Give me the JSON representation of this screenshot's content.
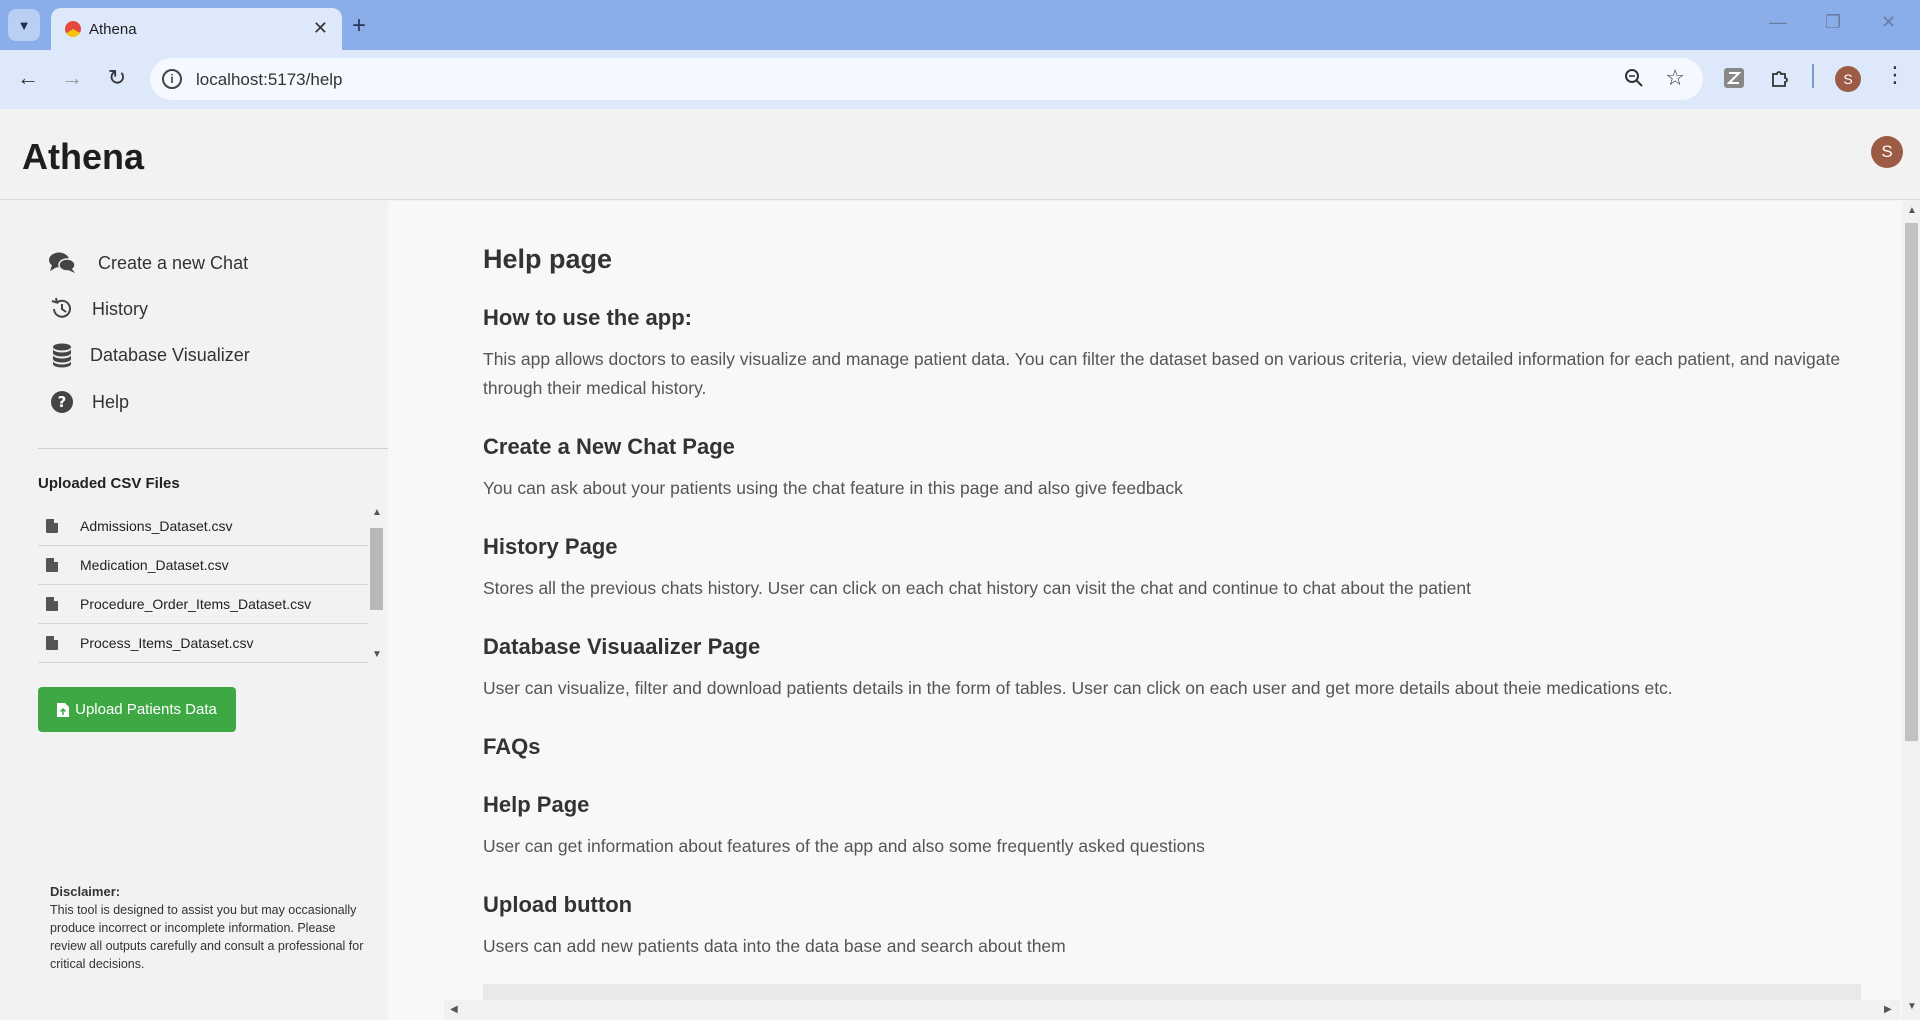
{
  "browser": {
    "tab_title": "Athena",
    "url": "localhost:5173/help",
    "profile_initial": "S"
  },
  "app": {
    "title": "Athena",
    "avatar_initial": "S"
  },
  "sidebar": {
    "nav": [
      {
        "label": "Create a new Chat",
        "icon": "chat-icon"
      },
      {
        "label": "History",
        "icon": "history-icon"
      },
      {
        "label": "Database Visualizer",
        "icon": "database-icon"
      },
      {
        "label": "Help",
        "icon": "help-icon"
      }
    ],
    "csv_title": "Uploaded CSV Files",
    "csv_files": [
      "Admissions_Dataset.csv",
      "Medication_Dataset.csv",
      "Procedure_Order_Items_Dataset.csv",
      "Process_Items_Dataset.csv"
    ],
    "upload_label": "Upload Patients Data",
    "disclaimer_title": "Disclaimer:",
    "disclaimer_text": "This tool is designed to assist you but may occasionally produce incorrect or incomplete information. Please review all outputs carefully and consult a professional for critical decisions."
  },
  "help": {
    "title": "Help page",
    "sections": [
      {
        "heading": "How to use the app:",
        "text": "This app allows doctors to easily visualize and manage patient data. You can filter the dataset based on various criteria, view detailed information for each patient, and navigate through their medical history."
      },
      {
        "heading": "Create a New Chat Page",
        "text": "You can ask about your patients using the chat feature in this page and also give feedback"
      },
      {
        "heading": "History Page",
        "text": "Stores all the previous chats history. User can click on each chat history can visit the chat and continue to chat about the patient"
      },
      {
        "heading": "Database Visuaalizer Page",
        "text": "User can visualize, filter and download patients details in the form of tables. User can click on each user and get more details about theie medications etc."
      },
      {
        "heading": "FAQs",
        "text": ""
      },
      {
        "heading": "Help Page",
        "text": "User can get information about features of the app and also some frequently asked questions"
      },
      {
        "heading": "Upload button",
        "text": "Users can add new patients data into the data base and search about them"
      }
    ]
  },
  "colors": {
    "accent_green": "#3ea845",
    "avatar_brown": "#9b5b45",
    "tabbar_blue": "#8aaee9"
  }
}
